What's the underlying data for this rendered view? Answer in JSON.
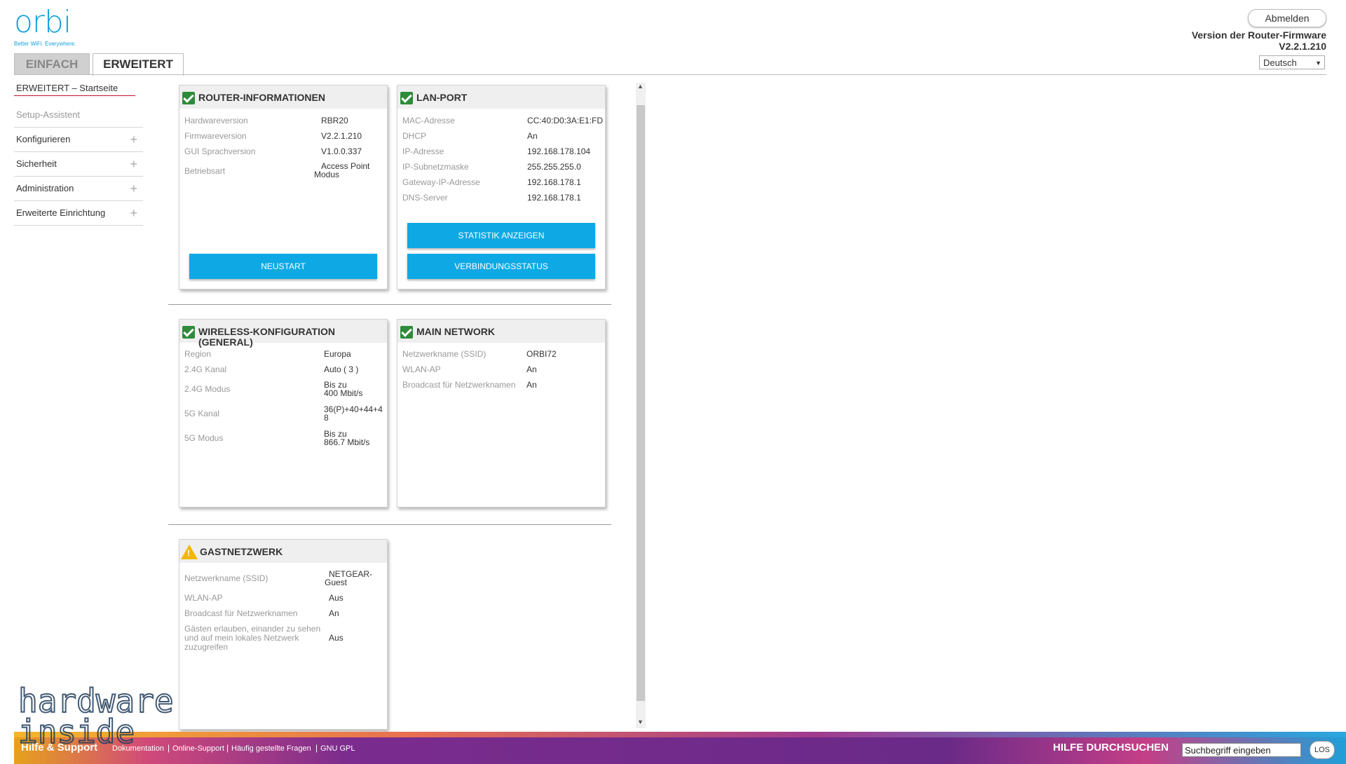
{
  "logo": {
    "word": "orbi",
    "tagline": "Better WiFi. Everywhere."
  },
  "header": {
    "logout_label": "Abmelden",
    "firmware_label": "Version der Router-Firmware",
    "firmware_version": "V2.2.1.210",
    "language": "Deutsch"
  },
  "tabs": {
    "basic": "EINFACH",
    "advanced": "ERWEITERT"
  },
  "sidebar": {
    "items": [
      {
        "label": "ERWEITERT – Startseite"
      },
      {
        "label": "Setup-Assistent"
      },
      {
        "label": "Konfigurieren"
      },
      {
        "label": "Sicherheit"
      },
      {
        "label": "Administration"
      },
      {
        "label": "Erweiterte Einrichtung"
      }
    ]
  },
  "router_info": {
    "title": "ROUTER-INFORMATIONEN",
    "rows": [
      {
        "label": "Hardwareversion",
        "value": "RBR20"
      },
      {
        "label": "Firmwareversion",
        "value": "V2.2.1.210"
      },
      {
        "label": "GUI Sprachversion",
        "value": "V1.0.0.337"
      },
      {
        "label": "Betriebsart",
        "value": "Access Point",
        "value2": "Modus"
      }
    ],
    "restart_button": "NEUSTART"
  },
  "lan_port": {
    "title": "LAN-PORT",
    "rows": [
      {
        "label": "MAC-Adresse",
        "value": "CC:40:D0:3A:E1:FD"
      },
      {
        "label": "DHCP",
        "value": "An"
      },
      {
        "label": "IP-Adresse",
        "value": "192.168.178.104"
      },
      {
        "label": "IP-Subnetzmaske",
        "value": "255.255.255.0"
      },
      {
        "label": "Gateway-IP-Adresse",
        "value": "192.168.178.1"
      },
      {
        "label": "DNS-Server",
        "value": "192.168.178.1"
      }
    ],
    "stats_button": "STATISTIK ANZEIGEN",
    "status_button": "VERBINDUNGSSTATUS"
  },
  "wireless": {
    "title": "WIRELESS-KONFIGURATION",
    "title2": "(GENERAL)",
    "rows": [
      {
        "label": "Region",
        "value": "Europa"
      },
      {
        "label": "2.4G Kanal",
        "value": "Auto ( 3 )"
      },
      {
        "label": "2.4G Modus",
        "value": "Bis zu",
        "value2": "400 Mbit/s"
      },
      {
        "label": "5G Kanal",
        "value": "36(P)+40+44+4",
        "value2": "8"
      },
      {
        "label": "5G Modus",
        "value": "Bis zu",
        "value2": "866.7 Mbit/s"
      }
    ]
  },
  "main_network": {
    "title": "MAIN NETWORK",
    "rows": [
      {
        "label": "Netzwerkname (SSID)",
        "value": "ORBI72"
      },
      {
        "label": "WLAN-AP",
        "value": "An"
      },
      {
        "label": "Broadcast für Netzwerknamen",
        "value": "An"
      }
    ]
  },
  "guest": {
    "title": "GASTNETZWERK",
    "rows": [
      {
        "label": "Netzwerkname (SSID)",
        "value": "NETGEAR-",
        "value2": "Guest"
      },
      {
        "label": "WLAN-AP",
        "value": "Aus"
      },
      {
        "label": "Broadcast für Netzwerknamen",
        "value": "An"
      },
      {
        "label": "Gästen erlauben, einander zu sehen",
        "label2": "und auf mein lokales Netzwerk",
        "label3": "zuzugreifen",
        "value": "Aus"
      }
    ]
  },
  "footer": {
    "help_label": "Hilfe & Support",
    "links": [
      "Dokumentation",
      "Online-Support",
      "Häufig gestellte Fragen",
      "GNU GPL"
    ],
    "search_label": "HILFE DURCHSUCHEN",
    "search_value": "Suchbegriff eingeben",
    "go_label": "LOS"
  },
  "watermark": {
    "line1": "hardware",
    "line2": "inside"
  }
}
